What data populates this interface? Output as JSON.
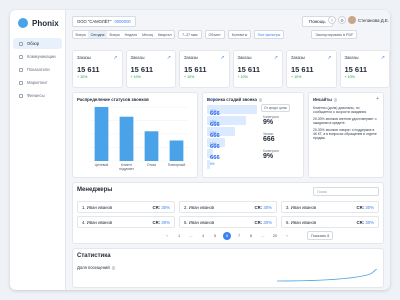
{
  "app": {
    "name": "Phonix"
  },
  "sidebar": {
    "items": [
      {
        "label": "Обзор",
        "active": true
      },
      {
        "label": "Коммуникации"
      },
      {
        "label": "Показатели"
      },
      {
        "label": "Маркетинг"
      },
      {
        "label": "Финансы"
      }
    ]
  },
  "header": {
    "org_name": "ООО \"САМОЛЁТ\"",
    "org_inn": "0000000",
    "help_label": "Помощь",
    "user_name": "Степанова Д.Е."
  },
  "filters": {
    "periods": [
      "Вчера",
      "Сегодня",
      "Вчера",
      "Неделя",
      "Месяц",
      "Квартал"
    ],
    "active_period_index": 1,
    "days_select": "7–37 мая",
    "object_select": "Объект",
    "contacts_select": "Контакты",
    "link_filter": "Все фильтры",
    "export_label": "Экспортировать в PDF"
  },
  "kpis": [
    {
      "title": "Заказы",
      "value": "15 611",
      "change": "+ 10%"
    },
    {
      "title": "Заказы",
      "value": "15 611",
      "change": "+ 10%"
    },
    {
      "title": "Заказы",
      "value": "15 611",
      "change": "+ 10%"
    },
    {
      "title": "Заказы",
      "value": "15 611",
      "change": "+ 10%"
    },
    {
      "title": "Заказы",
      "value": "15 611",
      "change": "+ 10%"
    },
    {
      "title": "Заказы",
      "value": "15 611",
      "change": "+ 10%"
    }
  ],
  "status_chart": {
    "title": "Распределение статусов звонков",
    "chart_data": {
      "type": "bar",
      "categories": [
        "Целевой",
        "Клиент подумает",
        "Отказ",
        "Повторный"
      ],
      "values": [
        100,
        82,
        55,
        38
      ],
      "ylim": [
        0,
        100
      ],
      "color": "#4aa3e8"
    }
  },
  "funnel": {
    "title": "Воронка стадий звонка",
    "filter": "От средн. цены",
    "rows": [
      {
        "pct": "10%",
        "value": "666",
        "fill": 1.0
      },
      {
        "pct": "41%",
        "value": "666",
        "fill": 0.78
      },
      {
        "pct": "10%",
        "value": "666",
        "fill": 0.55
      },
      {
        "pct": "10%",
        "value": "666",
        "fill": 0.35
      },
      {
        "pct": "10%",
        "value": "666",
        "fill": 0.12
      },
      {
        "pct": "5%",
        "value": "",
        "fill": 0.06
      }
    ],
    "stats": [
      {
        "label": "Конверсия",
        "value": "9%"
      },
      {
        "label": "Звонки",
        "value": "666"
      },
      {
        "label": "Конверсия",
        "value": "9%"
      }
    ]
  },
  "insights": {
    "title": "Инсайты",
    "paragraphs": [
      "Клиенты (доля) довольны, но сообщается о скорости ожидания.",
      "20-30% звонков агентов удостоверяют о ожидании в кредите.",
      "20-30% звонков говорят о поддержке в 4К КТ, а в вопросах обращения в отделе продаж."
    ]
  },
  "managers": {
    "title": "Менеджеры",
    "search_placeholder": "Поиск",
    "items": [
      {
        "rank": "1.",
        "name": "Иван иванов",
        "cr_label": "CR:",
        "cr": "30%"
      },
      {
        "rank": "2.",
        "name": "Иван иванов",
        "cr_label": "CR:",
        "cr": "30%"
      },
      {
        "rank": "3.",
        "name": "Иван иванов",
        "cr_label": "CR:",
        "cr": "30%"
      },
      {
        "rank": "4.",
        "name": "Иван иванов",
        "cr_label": "CR:",
        "cr": "30%"
      },
      {
        "rank": "5.",
        "name": "Иван иванов",
        "cr_label": "CR:",
        "cr": "30%"
      },
      {
        "rank": "6.",
        "name": "Иван иванов",
        "cr_label": "CR:",
        "cr": "30%"
      }
    ],
    "pagination": {
      "pages": [
        "1",
        "...",
        "4",
        "5",
        "6",
        "7",
        "8",
        "...",
        "20"
      ],
      "active": "6",
      "per_page": "Показать 8"
    }
  },
  "stats": {
    "title": "Статистика",
    "subtitle": "Доля посещений"
  }
}
